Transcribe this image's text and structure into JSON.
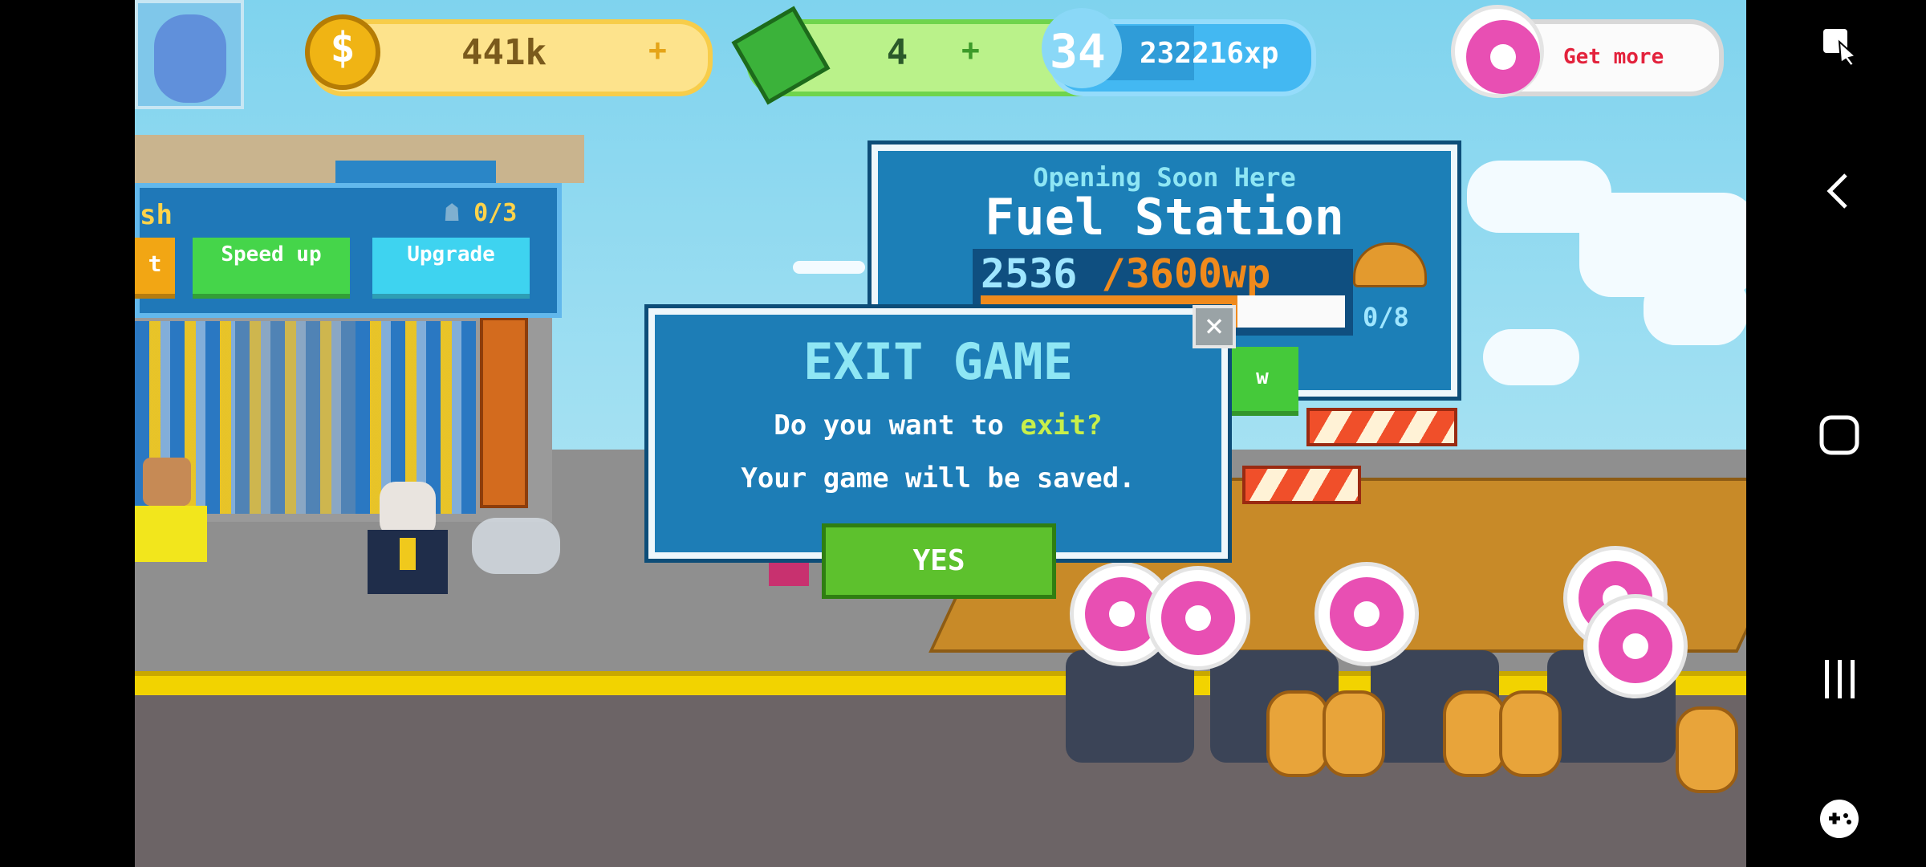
{
  "hud": {
    "coins": "441k",
    "cash": "4",
    "level": "34",
    "xp": "232216xp",
    "get_more": "Get more"
  },
  "wash_panel": {
    "title_partial": "sh",
    "workers": "0/3",
    "btn_left_partial": "t",
    "speed_up": "Speed up",
    "upgrade": "Upgrade"
  },
  "fuel_station": {
    "subtitle": "Opening Soon Here",
    "title": "Fuel Station",
    "progress_current": "2536",
    "progress_target": " /3600wp",
    "progress_fraction": 0.704,
    "slots": "0/8",
    "hidden_btn_partial": "w"
  },
  "dialog": {
    "title": "EXIT GAME",
    "line1_prefix": "Do you want to ",
    "line1_highlight": "exit?",
    "line2": "Your game will be saved.",
    "yes": "YES",
    "close": "×"
  },
  "colors": {
    "accent_green": "#5dc12d",
    "panel_blue": "#1d7db6",
    "donut_pink": "#e84fb3",
    "title_cyan": "#8ee6f4",
    "highlight_yellowgreen": "#c8ef4a",
    "progress_orange": "#f08a1c"
  }
}
